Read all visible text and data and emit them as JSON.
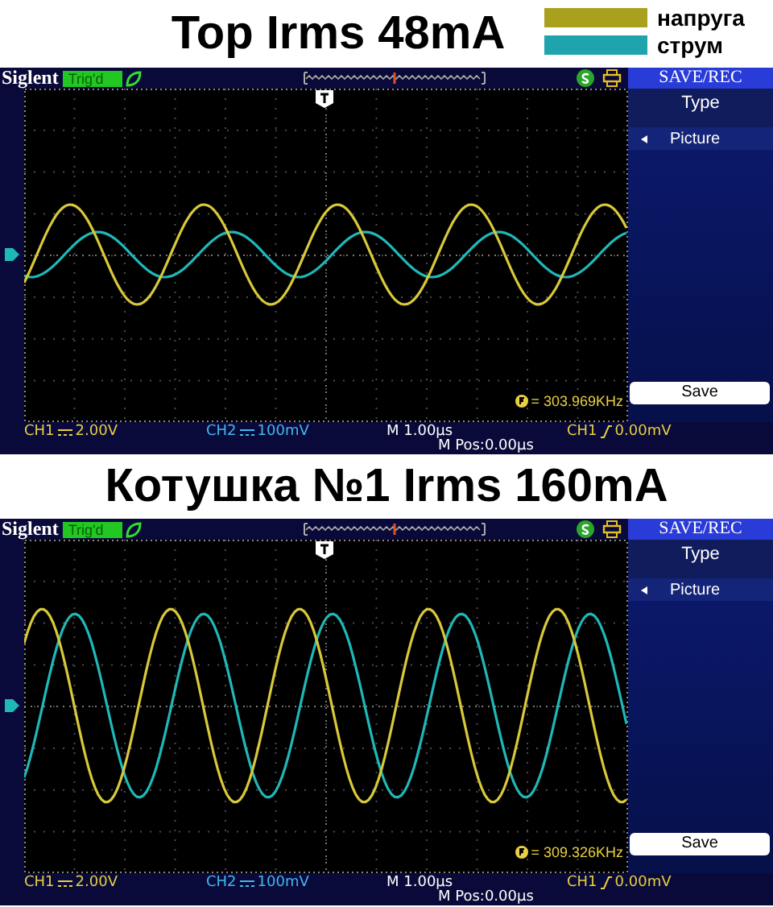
{
  "panels": [
    {
      "title": "Top Irms 48mA",
      "legend": [
        {
          "label": "напруга",
          "color": "#a9a01e"
        },
        {
          "label": "струм",
          "color": "#1fa3ad"
        }
      ],
      "scope": {
        "brand": "Siglent",
        "trigger_status": "Trig'd",
        "menu_title": "SAVE/REC",
        "menu_items": [
          {
            "label": "Type",
            "kind": "heading"
          },
          {
            "label": "Picture",
            "kind": "option"
          }
        ],
        "button": "Save",
        "frequency": "= 303.969KHz",
        "ch1_label": "CH1",
        "ch1_scale": "2.00V",
        "ch2_label": "CH2",
        "ch2_scale": "100mV",
        "timebase": "M 1.00μs",
        "position": "M Pos:0.00μs",
        "trigger_source": "CH1",
        "trigger_level": "0.00mV"
      }
    },
    {
      "title": "Котушка №1 Irms 160mA",
      "scope": {
        "brand": "Siglent",
        "trigger_status": "Trig'd",
        "menu_title": "SAVE/REC",
        "menu_items": [
          {
            "label": "Type",
            "kind": "heading"
          },
          {
            "label": "Picture",
            "kind": "option"
          }
        ],
        "button": "Save",
        "frequency": "= 309.326KHz",
        "ch1_label": "CH1",
        "ch1_scale": "2.00V",
        "ch2_label": "CH2",
        "ch2_scale": "100mV",
        "timebase": "M 1.00μs",
        "position": "M Pos:0.00μs",
        "trigger_source": "CH1",
        "trigger_level": "0.00mV"
      }
    }
  ]
}
